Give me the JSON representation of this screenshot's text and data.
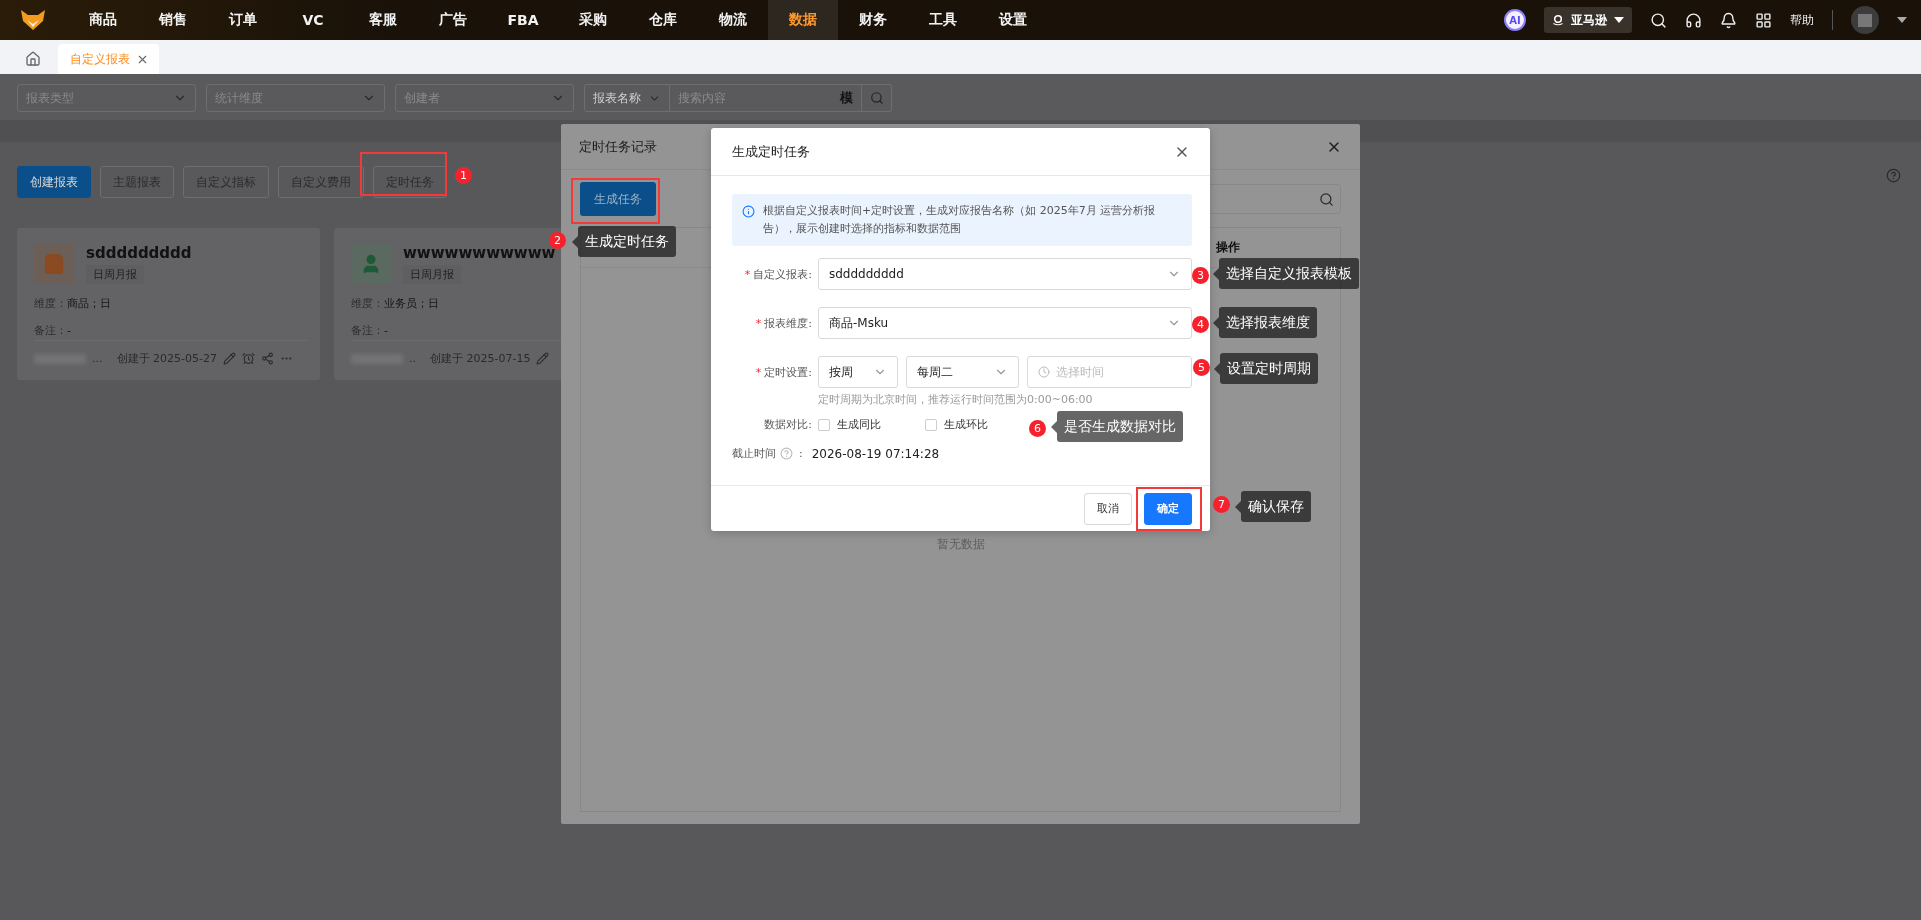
{
  "nav": {
    "items": [
      {
        "label": "商品",
        "selected": false
      },
      {
        "label": "销售",
        "selected": false
      },
      {
        "label": "订单",
        "selected": false
      },
      {
        "label": "VC",
        "selected": false
      },
      {
        "label": "客服",
        "selected": false
      },
      {
        "label": "广告",
        "selected": false
      },
      {
        "label": "FBA",
        "selected": false
      },
      {
        "label": "采购",
        "selected": false
      },
      {
        "label": "仓库",
        "selected": false
      },
      {
        "label": "物流",
        "selected": false
      },
      {
        "label": "数据",
        "selected": true
      },
      {
        "label": "财务",
        "selected": false
      },
      {
        "label": "工具",
        "selected": false
      },
      {
        "label": "设置",
        "selected": false
      }
    ],
    "ai_badge": "AI",
    "store": "亚马逊",
    "help": "帮助"
  },
  "tabs": [
    {
      "label": "自定义报表",
      "selected": true
    }
  ],
  "filters": [
    {
      "placeholder": "报表类型"
    },
    {
      "placeholder": "统计维度"
    },
    {
      "placeholder": "创建者"
    }
  ],
  "search": {
    "field": "报表名称",
    "placeholder": "搜索内容",
    "suffix": "模"
  },
  "toolbar": [
    {
      "label": "创建报表",
      "primary": true
    },
    {
      "label": "主题报表",
      "primary": false
    },
    {
      "label": "自定义指标",
      "primary": false
    },
    {
      "label": "自定义费用",
      "primary": false
    },
    {
      "label": "定时任务",
      "primary": false
    }
  ],
  "cards": [
    {
      "title": "sddddddddd",
      "tag": "日周月报",
      "dimension_label": "维度：",
      "dimension": "商品；日",
      "note_label": "备注：",
      "note": "-",
      "author": "...",
      "created": "创建于 2025-05-27"
    },
    {
      "title": "wwwwwwwwwww",
      "tag": "日周月报",
      "dimension_label": "维度：",
      "dimension": "业务员；日",
      "note_label": "备注：",
      "note": "-",
      "author": "..",
      "created": "创建于 2025-07-15"
    }
  ],
  "record_panel": {
    "title": "定时任务记录",
    "create_button": "生成任务",
    "column_header": "操作",
    "empty": "暂无数据"
  },
  "dialog": {
    "title": "生成定时任务",
    "info": "根据自定义报表时间+定时设置，生成对应报告名称（如 2025年7月 运营分析报告），展示创建时选择的指标和数据范围",
    "fields": [
      {
        "kind": "select",
        "required_mark": "*",
        "label": "自定义报表:",
        "value": "sddddddddd"
      },
      {
        "kind": "select",
        "required_mark": "*",
        "label": "报表维度:",
        "value": "商品-Msku"
      },
      {
        "kind": "schedule",
        "required_mark": "*",
        "label": "定时设置:",
        "period": "按周",
        "day": "每周二",
        "time_placeholder": "选择时间",
        "hint": "定时周期为北京时间，推荐运行时间范围为0:00~06:00"
      },
      {
        "kind": "checkboxes",
        "label": "数据对比:",
        "options": [
          {
            "label": "生成同比",
            "checked": false
          },
          {
            "label": "生成环比",
            "checked": false
          }
        ]
      },
      {
        "kind": "text",
        "label": "截止时间",
        "separator": ":",
        "value": "2026-08-19 07:14:28"
      }
    ],
    "cancel": "取消",
    "confirm": "确定"
  },
  "annotations": [
    {
      "number": "1",
      "highlight": true
    },
    {
      "number": "2",
      "text": "生成定时任务",
      "highlight": true
    },
    {
      "number": "3",
      "text": "选择自定义报表模板",
      "highlight": false
    },
    {
      "number": "4",
      "text": "选择报表维度",
      "highlight": false
    },
    {
      "number": "5",
      "text": "设置定时周期",
      "highlight": false
    },
    {
      "number": "6",
      "text": "是否生成数据对比",
      "highlight": false
    },
    {
      "number": "7",
      "text": "确认保存",
      "highlight": true
    }
  ]
}
